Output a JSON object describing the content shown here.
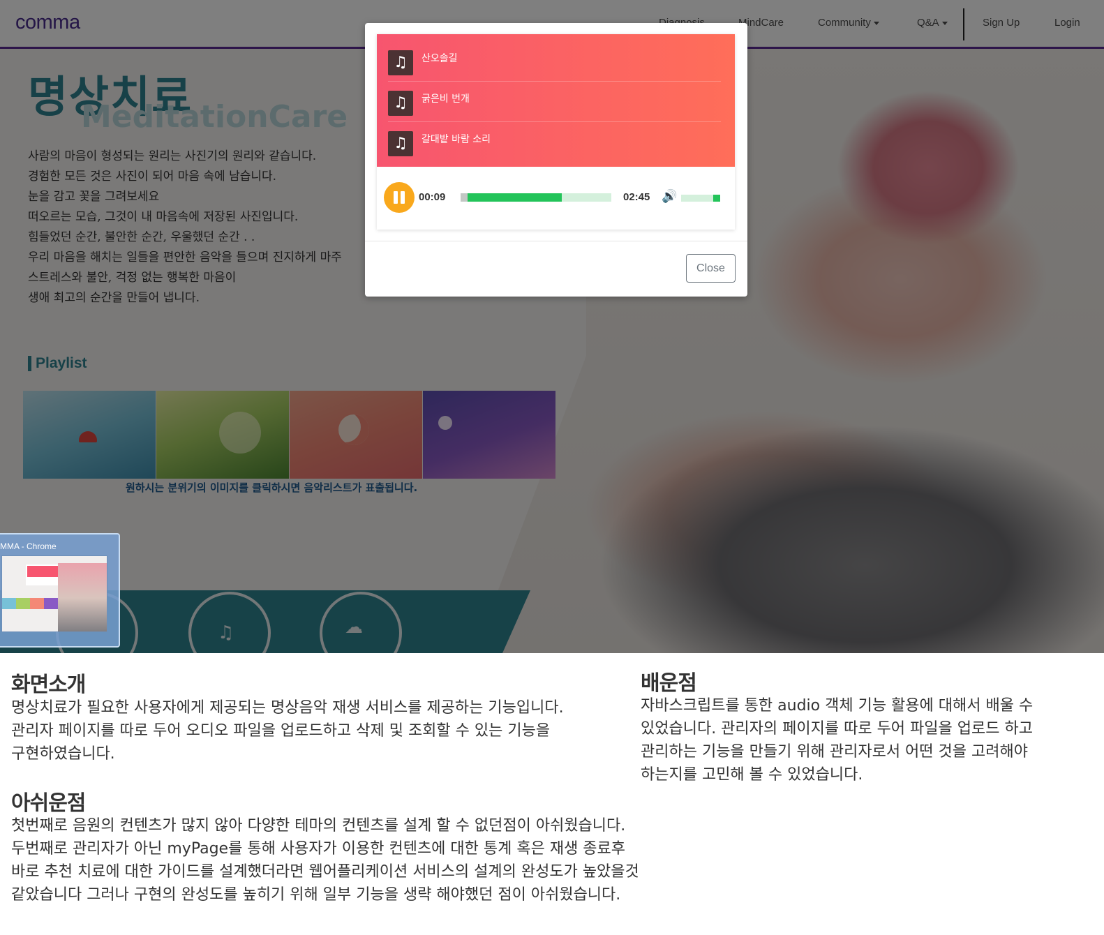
{
  "navbar": {
    "logo": "comma",
    "items": [
      "Diagnosis",
      "MindCare",
      "Community",
      "Q&A",
      "Sign Up",
      "Login"
    ]
  },
  "page": {
    "title": "명상치료",
    "subtitle": "MeditationCare",
    "intro_lines": [
      "사람의 마음이 형성되는 원리는 사진기의 원리와 같습니다.",
      "경험한 모든 것은 사진이 되어 마음 속에 남습니다.",
      "눈을 감고 꽃을 그려보세요",
      "떠오르는 모습, 그것이 내 마음속에 저장된 사진입니다.",
      "힘들었던 순간, 불안한 순간, 우울했던 순간 . .",
      "우리 마음을 해치는 일들을 편안한 음악을 들으며 진지하게 마주",
      "스트레스와 불안, 걱정 없는 행복한 마음이",
      "생애 최고의 순간을 만들어 냅니다."
    ],
    "playlist_heading": "Playlist",
    "playlist_caption": "원하시는 분위기의 이미지를 클릭하시면 음악리스트가 표출됩니다."
  },
  "taskbar_preview": {
    "title": "MMA - Chrome"
  },
  "player": {
    "tracks": [
      "산오솔길",
      "굵은비 번개",
      "갈대밭 바람 소리"
    ],
    "current_time": "00:09",
    "total_time": "02:45",
    "progress_fraction": 0.67,
    "volume_fraction": 1.0,
    "accent_color": "#23c45a",
    "play_button_color": "#f9a81c",
    "list_gradient": [
      "#f7556f",
      "#ff6e59"
    ]
  },
  "modal": {
    "close_label": "Close"
  },
  "sections": {
    "intro": {
      "title": "화면소개",
      "lines": [
        " 명상치료가 필요한 사용자에게 제공되는 명상음악 재생 서비스를 제공하는 기능입니다.",
        "관리자 페이지를 따로 두어 오디오 파일을 업로드하고 삭제 및 조회할 수 있는 기능을",
        "구현하였습니다."
      ]
    },
    "learned": {
      "title": "배운점",
      "lines": [
        " 자바스크립트를 통한 audio 객체 기능 활용에 대해서 배울 수",
        "있었습니다. 관리자의 페이지를 따로 두어 파일을 업로드 하고",
        "관리하는 기능을 만들기 위해 관리자로서 어떤 것을 고려해야",
        "하는지를 고민해 볼 수 있었습니다."
      ]
    },
    "regret": {
      "title": "아쉬운점",
      "lines": [
        " 첫번째로 음원의 컨텐츠가 많지 않아 다양한 테마의 컨텐츠를 설계 할 수 없던점이 아쉬웠습니다.",
        "두번째로 관리자가 아닌 myPage를 통해 사용자가 이용한 컨텐츠에 대한 통계 혹은 재생 종료후",
        "바로 추천 치료에 대한 가이드를 설계했더라면 웹어플리케이션 서비스의 설계의 완성도가 높았을것",
        "같았습니다 그러나 구현의 완성도를 높히기 위해 일부 기능을 생략 해야했던 점이 아쉬웠습니다."
      ]
    }
  }
}
